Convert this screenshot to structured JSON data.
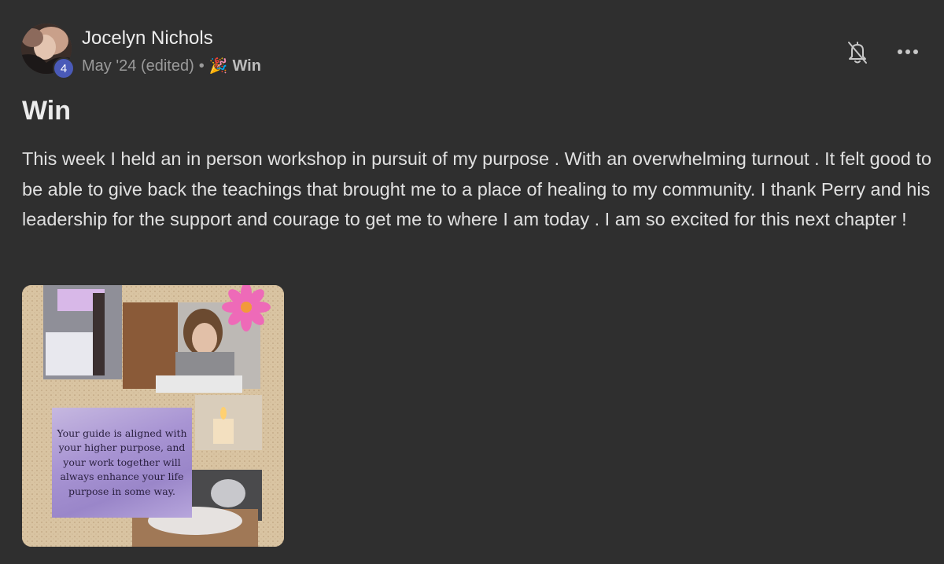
{
  "post": {
    "author": "Jocelyn Nichols",
    "level": "4",
    "date": "May '24 (edited)",
    "separator": "•",
    "category_icon": "party-popper-icon",
    "category_emoji": "🎉",
    "category": "Win",
    "title": "Win",
    "body": "This week I held an in person workshop in pursuit of my purpose . With an overwhelming turnout . It felt good to be able to give back the teachings that brought me to a place of healing to my community. I thank Perry and his leadership for the support and courage to get me to where I am today . I am so excited for this next chapter !"
  },
  "actions": {
    "notify_icon": "bell-off-icon",
    "more_icon": "more-horizontal-icon"
  },
  "attachment": {
    "quote": "Your guide is aligned with your higher purpose, and your work together will always enhance your life purpose in some way."
  },
  "colors": {
    "background": "#2f2f2f",
    "level_badge": "#4a5ab8"
  }
}
